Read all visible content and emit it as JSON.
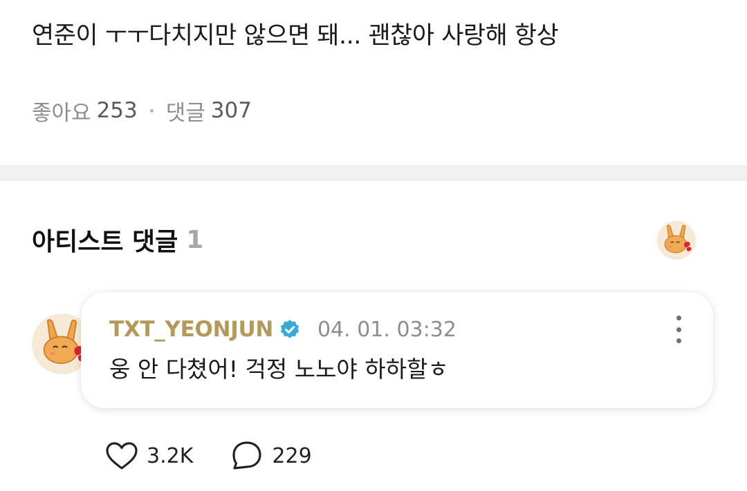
{
  "post": {
    "text": "연준이 ㅜㅜ다치지만 않으면 돼... 괜찮아 사랑해 항상",
    "likes_label": "좋아요",
    "likes_count": "253",
    "comments_label": "댓글",
    "comments_count": "307"
  },
  "artist_comments": {
    "title": "아티스트 댓글",
    "count": "1",
    "header_avatar": "rabbit-character-avatar"
  },
  "comment": {
    "author": "TXT_YEONJUN",
    "verified_icon": "verified-check-icon",
    "timestamp": "04. 01. 03:32",
    "text": "웅 안 다쳤어! 걱정 노노야 하하할ㅎ",
    "avatar": "rabbit-character-avatar",
    "menu_icon": "more-vertical-icon"
  },
  "actions": {
    "like_icon": "heart-icon",
    "like_count": "3.2K",
    "reply_icon": "comment-bubble-icon",
    "reply_count": "229"
  },
  "colors": {
    "author": "#b39a5c",
    "verified": "#3aa9d6",
    "muted": "#8e8e8e",
    "divider": "#f1f1f1",
    "avatar_bg": "#f6ead6"
  }
}
